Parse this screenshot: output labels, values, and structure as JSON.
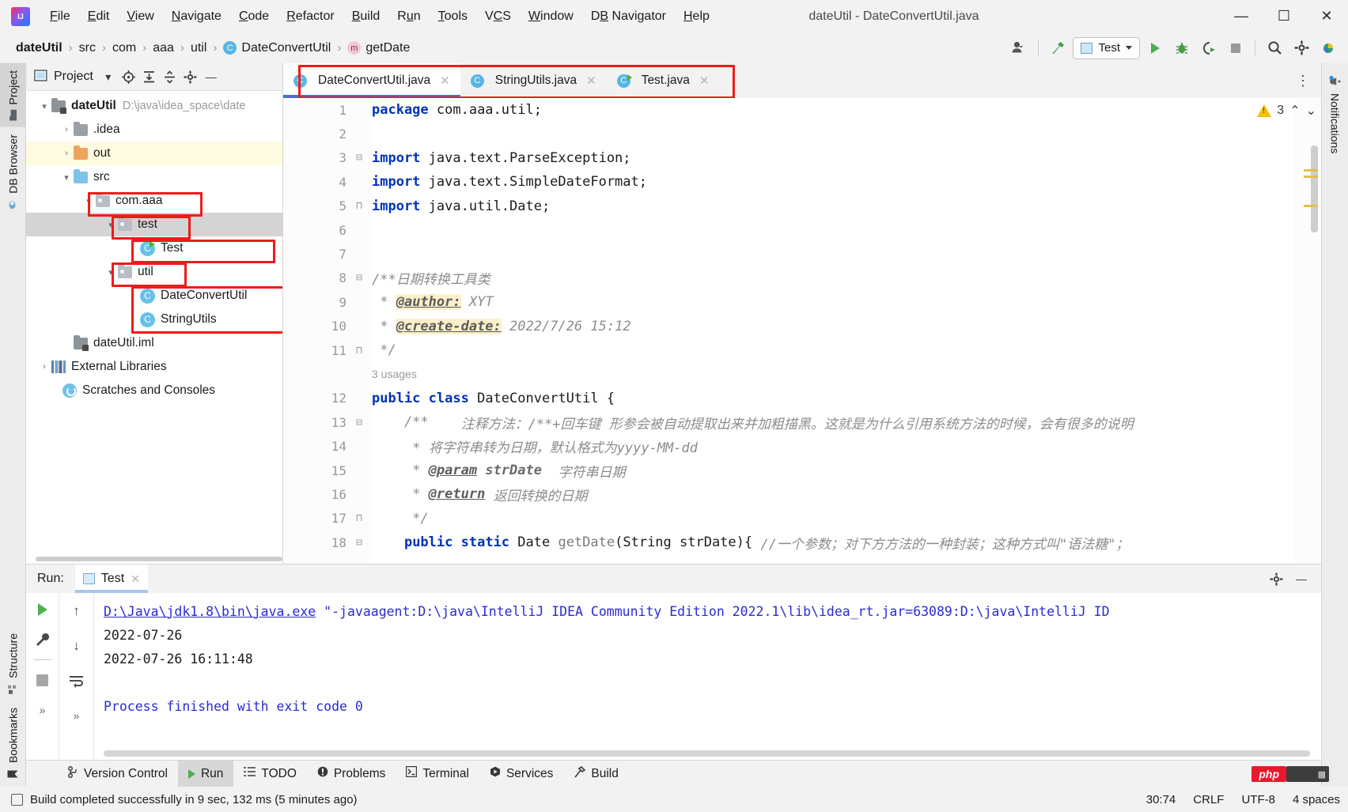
{
  "titlebar": {
    "logo": "intellij-idea-logo",
    "menus": [
      "File",
      "Edit",
      "View",
      "Navigate",
      "Code",
      "Refactor",
      "Build",
      "Run",
      "Tools",
      "VCS",
      "Window",
      "DB Navigator",
      "Help"
    ],
    "window_title": "dateUtil - DateConvertUtil.java",
    "minimize": "—",
    "maximize": "☐",
    "close": "✕"
  },
  "navbar": {
    "breadcrumbs": [
      {
        "label": "dateUtil",
        "bold": true,
        "badge": ""
      },
      {
        "label": "src",
        "bold": false,
        "badge": ""
      },
      {
        "label": "com",
        "bold": false,
        "badge": ""
      },
      {
        "label": "aaa",
        "bold": false,
        "badge": ""
      },
      {
        "label": "util",
        "bold": false,
        "badge": ""
      },
      {
        "label": "DateConvertUtil",
        "bold": false,
        "badge": "C"
      },
      {
        "label": "getDate",
        "bold": false,
        "badge": "m"
      }
    ],
    "separator": "›",
    "run_config": "Test",
    "icons": {
      "account": "account-icon",
      "hammer": "build-hammer-icon",
      "run": "run-icon",
      "debug": "debug-icon",
      "coverage": "run-with-coverage-icon",
      "stop": "stop-icon",
      "search": "search-everywhere-icon",
      "settings": "settings-gear-icon",
      "updates": "idea-updates-icon"
    }
  },
  "left_strip": [
    {
      "label": "Project",
      "icon": "project-folder-icon",
      "active": true
    },
    {
      "label": "DB Browser",
      "icon": "db-browser-icon",
      "active": false
    },
    {
      "label": "Structure",
      "icon": "structure-icon",
      "active": false
    },
    {
      "label": "Bookmarks",
      "icon": "bookmark-icon",
      "active": false
    }
  ],
  "right_strip": [
    {
      "label": "Notifications",
      "icon": "notifications-bell-icon"
    }
  ],
  "project_panel": {
    "title": "Project",
    "toolbar_icons": [
      "chevron-down-icon",
      "scroll-from-source-icon",
      "expand-all-icon",
      "collapse-all-icon",
      "gear-icon",
      "hide-icon"
    ],
    "tree": [
      {
        "indent": 0,
        "arrow": "⌄",
        "icon": "module-folder",
        "label": "dateUtil",
        "bold": true,
        "path": "D:\\java\\idea_space\\date",
        "highlight": ""
      },
      {
        "indent": 1,
        "arrow": "›",
        "icon": "folder-gray",
        "label": ".idea",
        "bold": false,
        "path": "",
        "highlight": ""
      },
      {
        "indent": 1,
        "arrow": "›",
        "icon": "folder-orange",
        "label": "out",
        "bold": false,
        "path": "",
        "highlight": "yellow"
      },
      {
        "indent": 1,
        "arrow": "⌄",
        "icon": "folder-blue",
        "label": "src",
        "bold": false,
        "path": "",
        "highlight": ""
      },
      {
        "indent": 2,
        "arrow": "⌄",
        "icon": "package",
        "label": "com.aaa",
        "bold": false,
        "path": "",
        "highlight": ""
      },
      {
        "indent": 3,
        "arrow": "⌄",
        "icon": "package",
        "label": "test",
        "bold": false,
        "path": "",
        "highlight": "gray"
      },
      {
        "indent": 4,
        "arrow": "",
        "icon": "class-runnable",
        "label": "Test",
        "bold": false,
        "path": "",
        "highlight": ""
      },
      {
        "indent": 3,
        "arrow": "⌄",
        "icon": "package",
        "label": "util",
        "bold": false,
        "path": "",
        "highlight": ""
      },
      {
        "indent": 4,
        "arrow": "",
        "icon": "class",
        "label": "DateConvertUtil",
        "bold": false,
        "path": "",
        "highlight": ""
      },
      {
        "indent": 4,
        "arrow": "",
        "icon": "class",
        "label": "StringUtils",
        "bold": false,
        "path": "",
        "highlight": ""
      },
      {
        "indent": 1,
        "arrow": "",
        "icon": "iml",
        "label": "dateUtil.iml",
        "bold": false,
        "path": "",
        "highlight": ""
      },
      {
        "indent": 0,
        "arrow": "›",
        "icon": "library",
        "label": "External Libraries",
        "bold": false,
        "path": "",
        "highlight": ""
      },
      {
        "indent": 0,
        "arrow": "",
        "icon": "scratches",
        "label": "Scratches and Consoles",
        "bold": false,
        "path": "",
        "highlight": ""
      }
    ]
  },
  "editor": {
    "tabs": [
      {
        "label": "DateConvertUtil.java",
        "badge": "C",
        "active": true,
        "runnable": false
      },
      {
        "label": "StringUtils.java",
        "badge": "C",
        "active": false,
        "runnable": false
      },
      {
        "label": "Test.java",
        "badge": "C",
        "active": false,
        "runnable": true
      }
    ],
    "warning_count": "3",
    "warning_icon": "warning-triangle-icon",
    "up_icon": "⌃",
    "down_icon": "⌄",
    "kebab": "⋮",
    "usages_hint": "3 usages",
    "lines": [
      {
        "no": "1",
        "fold": "",
        "segs": [
          {
            "t": "package",
            "c": "kw"
          },
          {
            "t": " com.aaa.util;",
            "c": "plain"
          }
        ]
      },
      {
        "no": "2",
        "fold": "",
        "segs": []
      },
      {
        "no": "3",
        "fold": "⊟",
        "segs": [
          {
            "t": "import",
            "c": "kw"
          },
          {
            "t": " java.text.ParseException;",
            "c": "plain"
          }
        ]
      },
      {
        "no": "4",
        "fold": "",
        "segs": [
          {
            "t": "import",
            "c": "kw"
          },
          {
            "t": " java.text.SimpleDateFormat;",
            "c": "plain"
          }
        ]
      },
      {
        "no": "5",
        "fold": "⊓",
        "segs": [
          {
            "t": "import",
            "c": "kw"
          },
          {
            "t": " java.util.Date;",
            "c": "plain"
          }
        ]
      },
      {
        "no": "6",
        "fold": "",
        "segs": []
      },
      {
        "no": "7",
        "fold": "",
        "segs": []
      },
      {
        "no": "8",
        "fold": "⊟",
        "segs": [
          {
            "t": "/**日期转换工具类",
            "c": "cmt"
          }
        ]
      },
      {
        "no": "9",
        "fold": "",
        "segs": [
          {
            "t": " * ",
            "c": "cmt"
          },
          {
            "t": "@author:",
            "c": "tag tag-hl"
          },
          {
            "t": " XYT",
            "c": "cmt"
          }
        ]
      },
      {
        "no": "10",
        "fold": "",
        "segs": [
          {
            "t": " * ",
            "c": "cmt"
          },
          {
            "t": "@create-date:",
            "c": "tag tag-hl"
          },
          {
            "t": " 2022/7/26 15:12",
            "c": "cmt"
          }
        ]
      },
      {
        "no": "11",
        "fold": "⊓",
        "segs": [
          {
            "t": " */",
            "c": "cmt"
          }
        ]
      },
      {
        "no": "12",
        "fold": "",
        "segs": [
          {
            "t": "public",
            "c": "kw"
          },
          {
            "t": " ",
            "c": "plain"
          },
          {
            "t": "class",
            "c": "kw"
          },
          {
            "t": " DateConvertUtil {",
            "c": "plain"
          }
        ]
      },
      {
        "no": "13",
        "fold": "⊟",
        "segs": [
          {
            "t": "    /**    ",
            "c": "cmt"
          },
          {
            "t": "注释方法：/**+回车键 形参会被自动提取出来并加粗描黑。这就是为什么引用系统方法的时候，会有很多的说明",
            "c": "cmt"
          }
        ]
      },
      {
        "no": "14",
        "fold": "",
        "segs": [
          {
            "t": "     * 将字符串转为日期，默认格式为yyyy-MM-dd",
            "c": "cmt"
          }
        ]
      },
      {
        "no": "15",
        "fold": "",
        "segs": [
          {
            "t": "     * ",
            "c": "cmt"
          },
          {
            "t": "@param",
            "c": "tag"
          },
          {
            "t": " ",
            "c": "cmt"
          },
          {
            "t": "strDate",
            "c": "cmt-b"
          },
          {
            "t": "  字符串日期",
            "c": "cmt"
          }
        ]
      },
      {
        "no": "16",
        "fold": "",
        "segs": [
          {
            "t": "     * ",
            "c": "cmt"
          },
          {
            "t": "@return",
            "c": "tag"
          },
          {
            "t": " 返回转换的日期",
            "c": "cmt"
          }
        ]
      },
      {
        "no": "17",
        "fold": "⊓",
        "segs": [
          {
            "t": "     */",
            "c": "cmt"
          }
        ]
      },
      {
        "no": "18",
        "fold": "⊟",
        "segs": [
          {
            "t": "    ",
            "c": "plain"
          },
          {
            "t": "public",
            "c": "kw"
          },
          {
            "t": " ",
            "c": "plain"
          },
          {
            "t": "static",
            "c": "kw"
          },
          {
            "t": " Date ",
            "c": "plain"
          },
          {
            "t": "getDate",
            "c": "mth"
          },
          {
            "t": "(String strDate){ ",
            "c": "plain"
          },
          {
            "t": "//一个参数；对下方方法的一种封装；这种方式叫\"语法糖\"；",
            "c": "cmt"
          }
        ]
      }
    ]
  },
  "run_panel": {
    "label": "Run:",
    "tab": "Test",
    "tab_close": "✕",
    "header_icons": [
      "settings-gear-icon",
      "hide-icon"
    ],
    "tool_icons": [
      "rerun-icon",
      "wrench-icon",
      "stop-icon",
      "more-icon"
    ],
    "tool_icons2": [
      "up-arrow-icon",
      "down-arrow-icon",
      "soft-wrap-icon",
      "more-icon"
    ],
    "console": [
      {
        "segs": [
          {
            "t": "D:\\Java\\jdk1.8\\bin\\java.exe",
            "c": "clink"
          },
          {
            "t": " \"-javaagent:D:\\java\\IntelliJ IDEA Community Edition 2022.1\\lib\\idea_rt.jar=63089:D:\\java\\IntelliJ ID",
            "c": "cblue"
          }
        ]
      },
      {
        "segs": [
          {
            "t": "2022-07-26",
            "c": "cnorm"
          }
        ]
      },
      {
        "segs": [
          {
            "t": "2022-07-26 16:11:48",
            "c": "cnorm"
          }
        ]
      },
      {
        "segs": []
      },
      {
        "segs": [
          {
            "t": "Process finished with exit code 0",
            "c": "cblue"
          }
        ]
      }
    ]
  },
  "bottom_tabs": [
    {
      "label": "Version Control",
      "icon": "branch-icon",
      "active": false
    },
    {
      "label": "Run",
      "icon": "run-triangle-icon",
      "active": true
    },
    {
      "label": "TODO",
      "icon": "todo-list-icon",
      "active": false
    },
    {
      "label": "Problems",
      "icon": "problems-icon",
      "active": false
    },
    {
      "label": "Terminal",
      "icon": "terminal-icon",
      "active": false
    },
    {
      "label": "Services",
      "icon": "services-icon",
      "active": false
    },
    {
      "label": "Build",
      "icon": "build-icon",
      "active": false
    }
  ],
  "statusbar": {
    "message": "Build completed successfully in 9 sec, 132 ms (5 minutes ago)",
    "message_icon": "build-status-icon",
    "caret": "30:74",
    "line_separator": "CRLF",
    "encoding": "UTF-8",
    "indent": "4 spaces",
    "php_badge": "php"
  },
  "colors": {
    "accent_blue": "#3b76c9",
    "keyword": "#0033b3",
    "comment": "#8c8c8c",
    "annotation_red": "#ef1b1b",
    "link_blue": "#2b2bd0",
    "warning_yellow": "#f2c200",
    "run_green": "#4caf50"
  }
}
